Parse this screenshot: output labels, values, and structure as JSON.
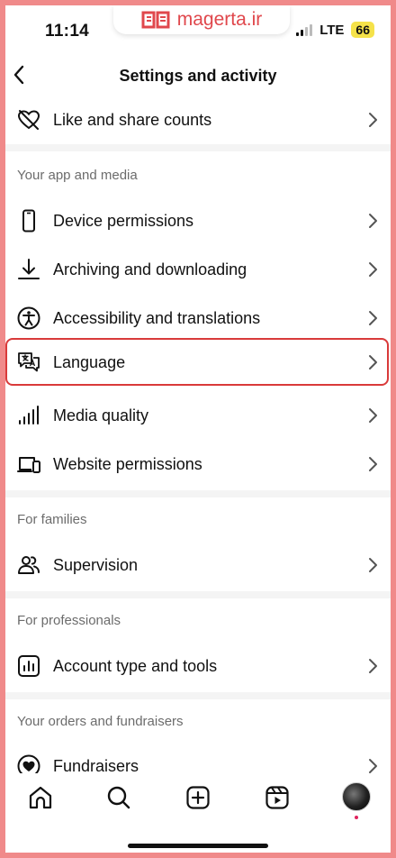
{
  "status_bar": {
    "time": "11:14",
    "network": "LTE",
    "battery": "66"
  },
  "watermark": {
    "text": "magerta.ir",
    "color": "#e0474c"
  },
  "header": {
    "title": "Settings and activity",
    "back_icon": "chevron-left-icon"
  },
  "sections": [
    {
      "items": [
        {
          "label": "Like and share counts",
          "icon": "heart-slash-icon"
        }
      ]
    },
    {
      "title": "Your app and media",
      "items": [
        {
          "label": "Device permissions",
          "icon": "phone-icon"
        },
        {
          "label": "Archiving and downloading",
          "icon": "download-icon"
        },
        {
          "label": "Accessibility and translations",
          "icon": "accessibility-icon"
        },
        {
          "label": "Language",
          "icon": "translate-bubble-icon",
          "highlighted": true
        },
        {
          "label": "Media quality",
          "icon": "signal-bars-icon"
        },
        {
          "label": "Website permissions",
          "icon": "devices-icon"
        }
      ]
    },
    {
      "title": "For families",
      "items": [
        {
          "label": "Supervision",
          "icon": "people-icon"
        }
      ]
    },
    {
      "title": "For professionals",
      "items": [
        {
          "label": "Account type and tools",
          "icon": "bar-chart-icon"
        }
      ]
    },
    {
      "title": "Your orders and fundraisers",
      "items": [
        {
          "label": "Fundraisers",
          "icon": "heart-coin-icon"
        }
      ]
    }
  ],
  "tabbar": [
    {
      "icon": "home-icon"
    },
    {
      "icon": "search-icon"
    },
    {
      "icon": "create-icon"
    },
    {
      "icon": "reels-icon"
    },
    {
      "icon": "profile-avatar"
    }
  ],
  "colors": {
    "highlight_border": "#d93a3a",
    "section_text": "#6c6c6c",
    "frame": "#f08a8a"
  }
}
